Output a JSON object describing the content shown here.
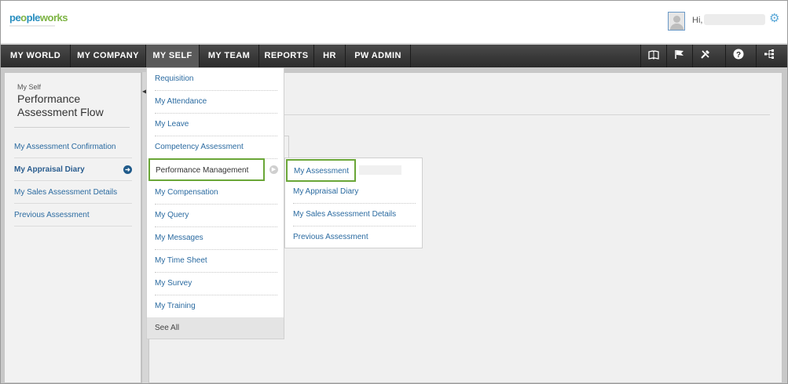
{
  "header": {
    "logo": {
      "part1": "pe",
      "part2": "o",
      "part3": "ple",
      "part4": "works"
    },
    "greeting": "Hi,"
  },
  "nav": {
    "items": [
      {
        "label": "MY WORLD"
      },
      {
        "label": "MY COMPANY"
      },
      {
        "label": "MY SELF"
      },
      {
        "label": "MY TEAM"
      },
      {
        "label": "REPORTS"
      },
      {
        "label": "HR"
      },
      {
        "label": "PW ADMIN"
      }
    ],
    "active": "MY SELF",
    "icons": [
      "book-icon",
      "flag-icon",
      "tools-icon",
      "help-icon",
      "sitemap-icon"
    ]
  },
  "sidebar": {
    "section": "My Self",
    "title": "Performance Assessment Flow",
    "items": [
      {
        "label": "My Assessment Confirmation"
      },
      {
        "label": "My Appraisal Diary"
      },
      {
        "label": "My Sales Assessment Details"
      },
      {
        "label": "Previous Assessment"
      }
    ]
  },
  "menu": {
    "items": [
      {
        "label": "Requisition"
      },
      {
        "label": "My Attendance"
      },
      {
        "label": "My Leave"
      },
      {
        "label": "Competency Assessment"
      },
      {
        "label": "Performance Management"
      },
      {
        "label": "My Compensation"
      },
      {
        "label": "My Query"
      },
      {
        "label": "My Messages"
      },
      {
        "label": "My Time Sheet"
      },
      {
        "label": "My Survey"
      },
      {
        "label": "My Training"
      }
    ],
    "see_all": "See All"
  },
  "submenu": {
    "items": [
      {
        "label": "My Assessment"
      },
      {
        "label": "My Appraisal Diary"
      },
      {
        "label": "My Sales Assessment Details"
      },
      {
        "label": "Previous Assessment"
      }
    ]
  },
  "colors": {
    "highlight_border": "#6aa637",
    "link": "#2a6aa0",
    "nav_bg": "#2b2b2b"
  }
}
